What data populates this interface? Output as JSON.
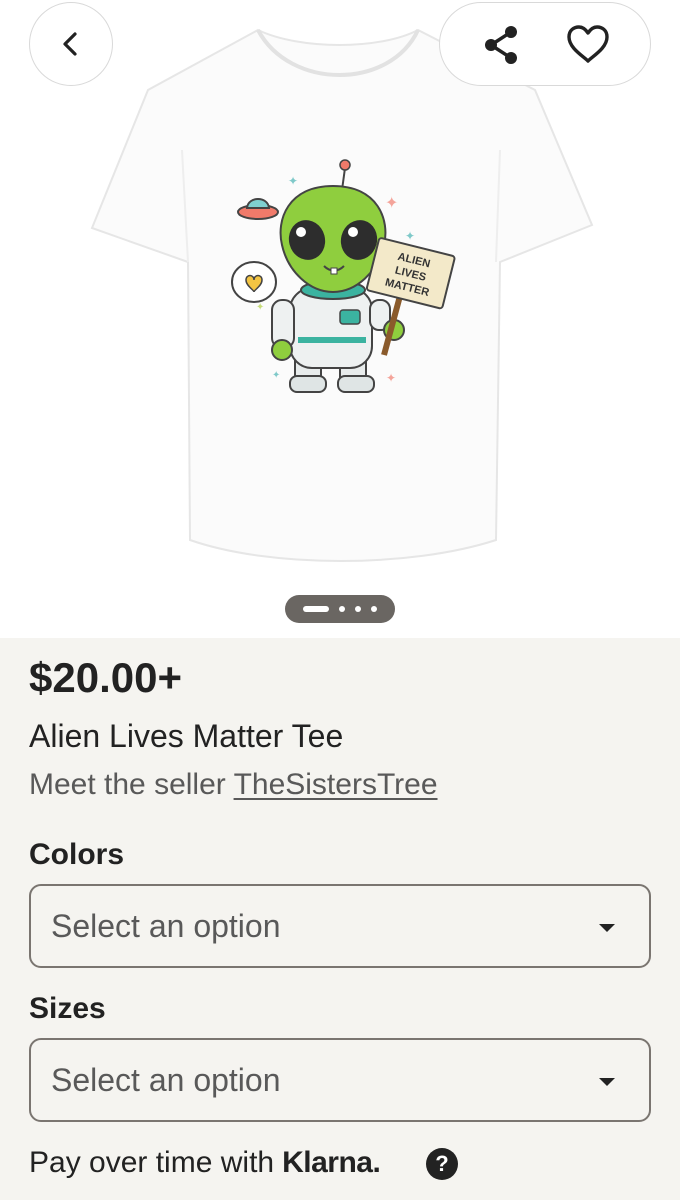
{
  "product": {
    "price": "$20.00+",
    "title": "Alien Lives Matter Tee",
    "seller_prefix": "Meet the seller ",
    "seller_name": "TheSistersTree",
    "sign_text": [
      "ALIEN",
      "LIVES",
      "MATTER"
    ]
  },
  "gallery": {
    "current_index": 1,
    "total_images": 4
  },
  "options": {
    "colors_label": "Colors",
    "colors_value": "Select an option",
    "sizes_label": "Sizes",
    "sizes_value": "Select an option"
  },
  "payment": {
    "text": "Pay over time with",
    "brand": "Klarna.",
    "help_glyph": "?"
  },
  "icons": {
    "back": "chevron-left-icon",
    "share": "share-icon",
    "favorite": "heart-icon",
    "dropdown": "caret-down-icon",
    "help": "question-circle-icon"
  },
  "colors": {
    "page_bg": "#f5f4f0",
    "text": "#222222",
    "muted_text": "#595959",
    "border": "#7a7570",
    "alien_green": "#8fce3e",
    "suit_teal": "#3bb3a0"
  }
}
